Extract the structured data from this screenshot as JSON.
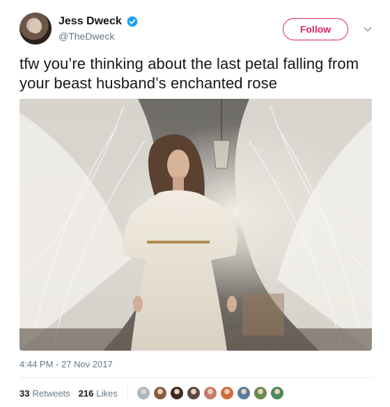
{
  "author": {
    "display_name": "Jess Dweck",
    "handle": "@TheDweck",
    "verified_icon": "verified-badge-icon"
  },
  "follow": {
    "label": "Follow",
    "color": "#e0245e"
  },
  "tweet": {
    "text": "tfw you’re thinking about the last petal falling from your beast husband’s enchanted rose"
  },
  "timestamp": "4:44 PM - 27 Nov 2017",
  "stats": {
    "retweets_count": "33",
    "retweets_label": "Retweets",
    "likes_count": "216",
    "likes_label": "Likes"
  },
  "liker_avatars": [
    {
      "color": "#aab8c2"
    },
    {
      "color": "#8a5a3c"
    },
    {
      "color": "#3b2a24"
    },
    {
      "color": "#5a4a44"
    },
    {
      "color": "#c97a6a"
    },
    {
      "color": "#d06a3a"
    },
    {
      "color": "#5a7a9a"
    },
    {
      "color": "#6a8a4a"
    },
    {
      "color": "#4a8a5a"
    }
  ],
  "colors": {
    "accent": "#e0245e",
    "verified": "#1da1f2",
    "secondary_text": "#657786"
  }
}
